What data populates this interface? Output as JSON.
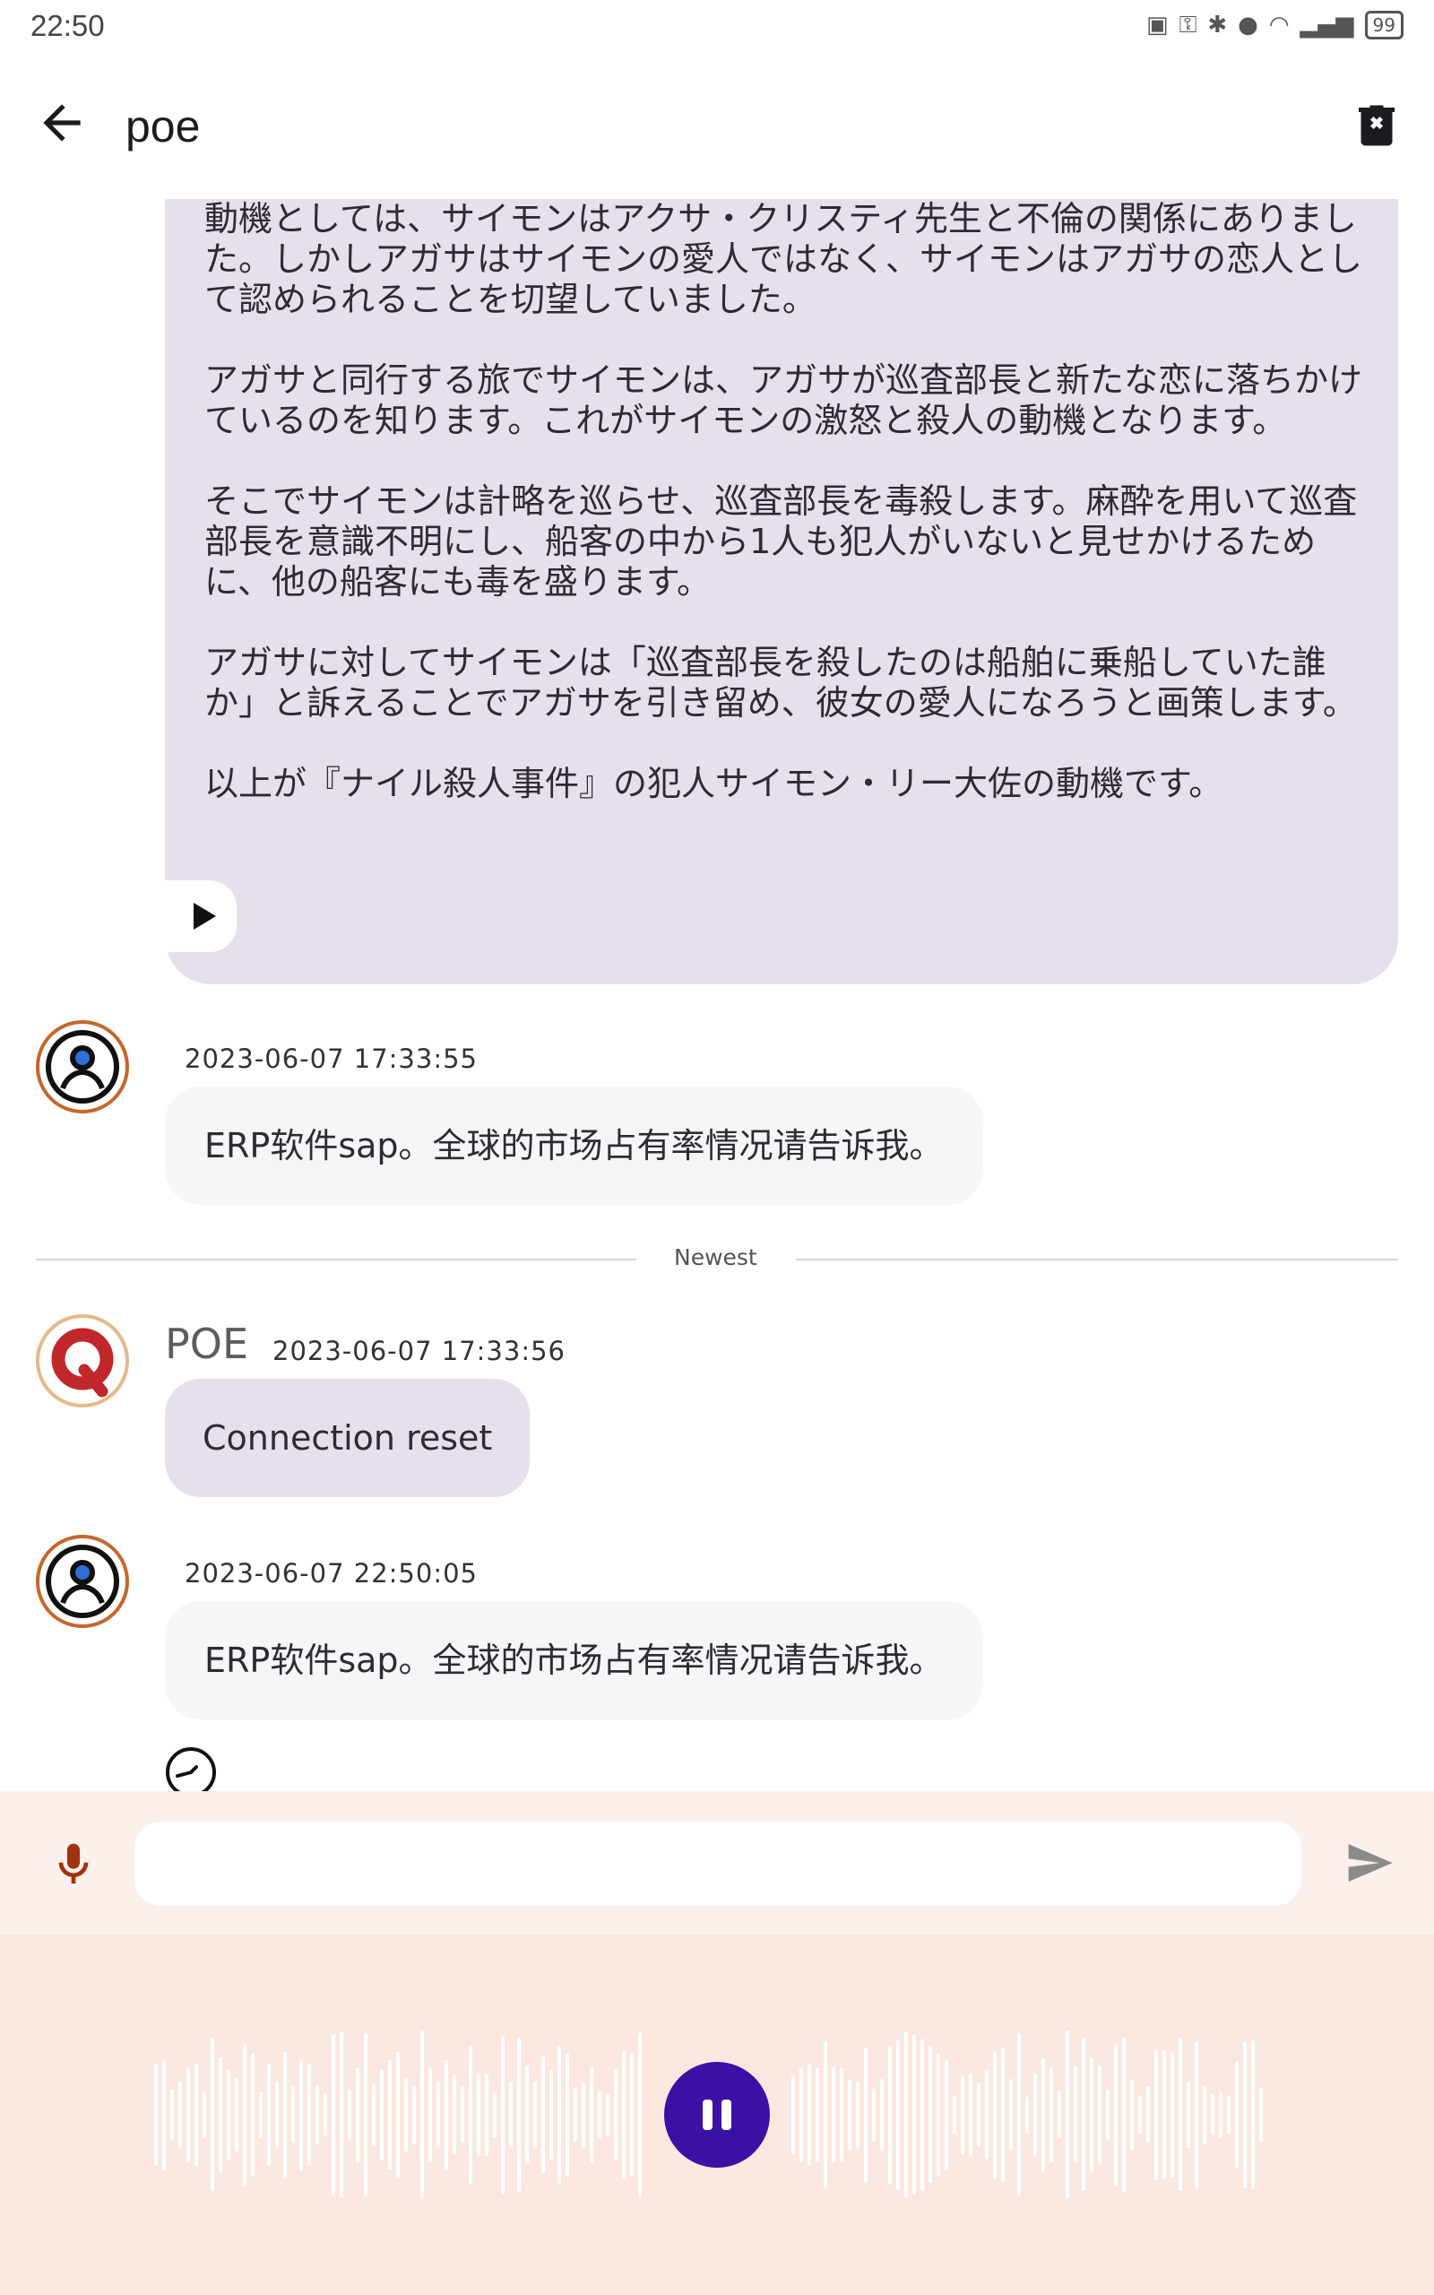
{
  "status_bar": {
    "time": "22:50",
    "battery": "99"
  },
  "header": {
    "title": "poe"
  },
  "bot_long_message": {
    "text": "動機としては、サイモンはアクサ・クリスティ先生と不倫の関係にありました。しかしアガサはサイモンの愛人ではなく、サイモンはアガサの恋人として認められることを切望していました。\n\nアガサと同行する旅でサイモンは、アガサが巡査部長と新たな恋に落ちかけているのを知ります。これがサイモンの激怒と殺人の動機となります。\n\nそこでサイモンは計略を巡らせ、巡査部長を毒殺します。麻酔を用いて巡査部長を意識不明にし、船客の中から1人も犯人がいないと見せかけるために、他の船客にも毒を盛ります。\n\nアガサに対してサイモンは「巡査部長を殺したのは船舶に乗船していた誰か」と訴えることでアガサを引き留め、彼女の愛人になろうと画策します。\n\n以上が『ナイル殺人事件』の犯人サイモン・リー大佐の動機です。"
  },
  "messages": [
    {
      "role": "user",
      "timestamp": "2023-06-07 17:33:55",
      "text": "ERP软件sap。全球的市场占有率情况请告诉我。"
    },
    {
      "role": "bot",
      "sender": "POE",
      "timestamp": "2023-06-07 17:33:56",
      "text": "Connection reset"
    },
    {
      "role": "user",
      "timestamp": "2023-06-07 22:50:05",
      "text": "ERP软件sap。全球的市场占有率情况请告诉我。"
    }
  ],
  "divider": {
    "label": "Newest"
  },
  "input": {
    "placeholder": ""
  },
  "colors": {
    "bot_bubble": "#e6e0ec",
    "user_bubble": "#f6f5f8",
    "pause_button": "#3a11a4",
    "voice_panel": "#fae8e0"
  }
}
